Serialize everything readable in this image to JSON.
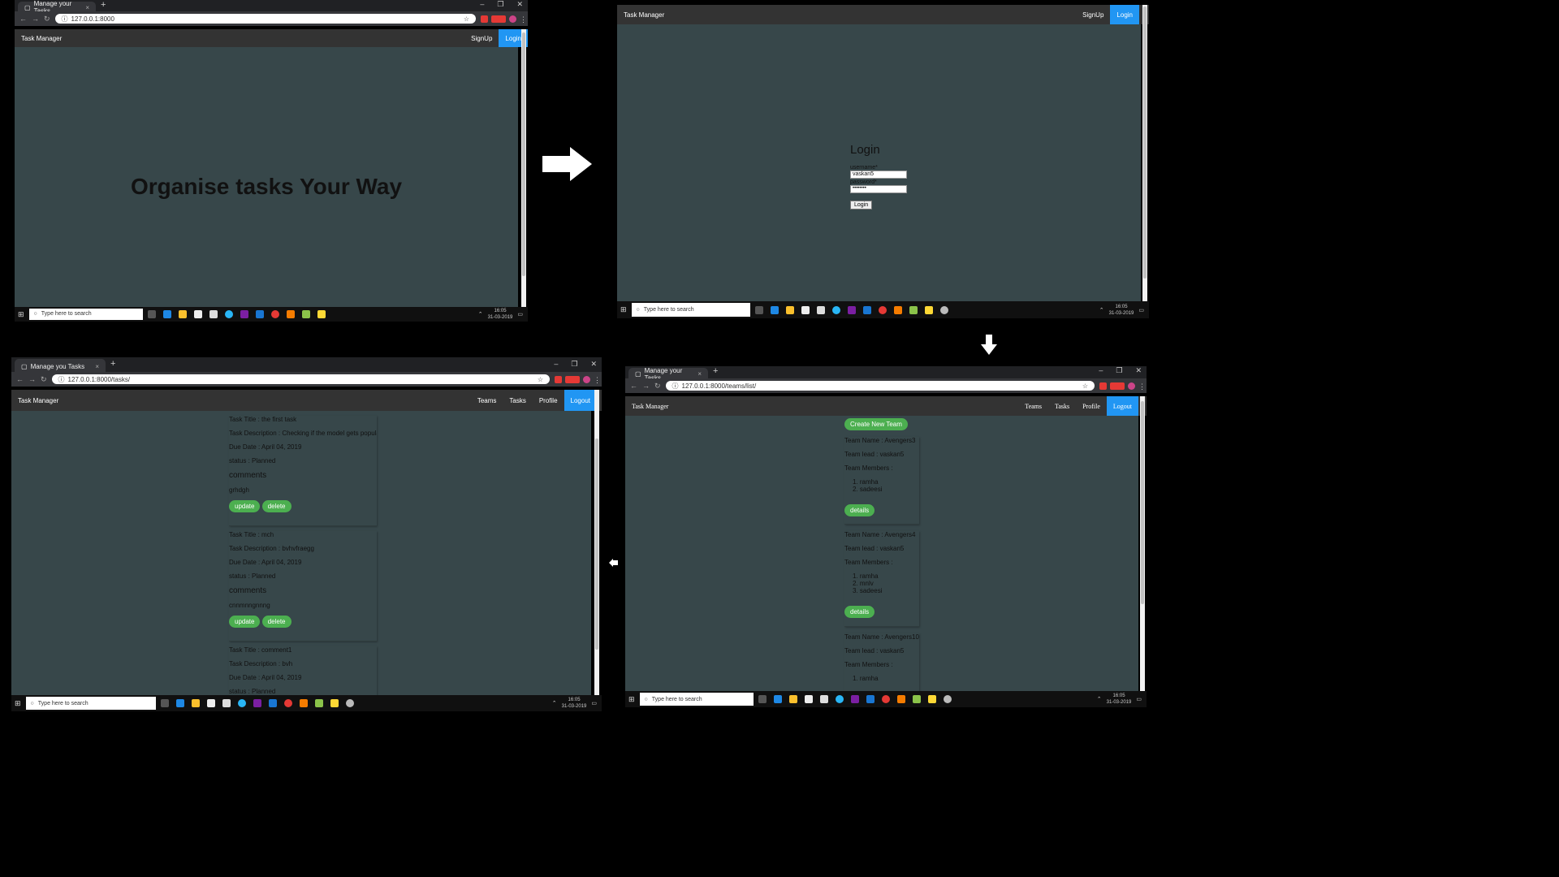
{
  "colors": {
    "navbar": "#333333",
    "content": "#37474a",
    "active_nav": "#2196f3",
    "green_button": "#4caf50"
  },
  "screen1": {
    "tab_title": "Manage your Tasks",
    "url": "127.0.0.1:8000",
    "navbar": {
      "brand": "Task Manager",
      "signup": "SignUp",
      "login": "Login"
    },
    "hero_text": "Organise tasks Your Way",
    "taskbar": {
      "search_placeholder": "Type here to search",
      "time": "16:05",
      "date": "31-03-2019"
    }
  },
  "screen2": {
    "navbar": {
      "brand": "Task Manager",
      "signup": "SignUp",
      "login": "Login"
    },
    "login_form": {
      "heading": "Login",
      "username_label": "username*",
      "username_value": "vaskan5",
      "password_label": "password*",
      "password_value": "••••••••",
      "submit": "Login"
    },
    "taskbar": {
      "search_placeholder": "Type here to search",
      "time": "16:05",
      "date": "31-03-2019"
    }
  },
  "screen3": {
    "tab_title": "Manage you Tasks",
    "url": "127.0.0.1:8000/tasks/",
    "navbar": {
      "brand": "Task Manager",
      "teams": "Teams",
      "tasks": "Tasks",
      "profile": "Profile",
      "logout": "Logout"
    },
    "tasks": [
      {
        "title": "Task Title : the first task",
        "description": "Task Description : Checking if the model gets populated",
        "due": "Due Date : April 04, 2019",
        "status": "status : Planned",
        "comments_heading": "comments",
        "comment": "grhdgh",
        "update": "update",
        "delete": "delete"
      },
      {
        "title": "Task Title : mch",
        "description": "Task Description : bvhvfraegg",
        "due": "Due Date : April 04, 2019",
        "status": "status : Planned",
        "comments_heading": "comments",
        "comment": "cnnmnngnnng",
        "update": "update",
        "delete": "delete"
      },
      {
        "title": "Task Title : comment1",
        "description": "Task Description : bvh",
        "due": "Due Date : April 04, 2019",
        "status": "status : Planned"
      }
    ],
    "taskbar": {
      "search_placeholder": "Type here to search",
      "time": "16:05",
      "date": "31-03-2019"
    }
  },
  "screen4": {
    "tab_title": "Manage your Tasks",
    "url": "127.0.0.1:8000/teams/list/",
    "navbar": {
      "brand": "Task Manager",
      "teams": "Teams",
      "tasks": "Tasks",
      "profile": "Profile",
      "logout": "Logout"
    },
    "create_button": "Create New Team",
    "teams": [
      {
        "name": "Team Name : Avengers3",
        "lead": "Team lead : vaskan5",
        "members_label": "Team Members :",
        "members": [
          "1. ramha",
          "2. sadeesi"
        ],
        "details": "details"
      },
      {
        "name": "Team Name : Avengers4",
        "lead": "Team lead : vaskan5",
        "members_label": "Team Members :",
        "members": [
          "1. ramha",
          "2. mnlv",
          "3. sadeesi"
        ],
        "details": "details"
      },
      {
        "name": "Team Name : Avengers10",
        "lead": "Team lead : vaskan5",
        "members_label": "Team Members :",
        "members": [
          "1. ramha"
        ]
      }
    ],
    "taskbar": {
      "search_placeholder": "Type here to search",
      "time": "16:05",
      "date": "31-03-2019"
    }
  }
}
